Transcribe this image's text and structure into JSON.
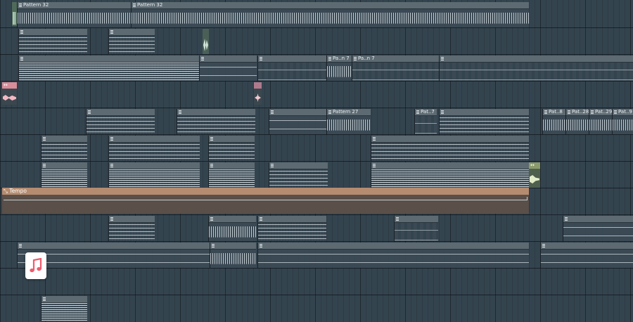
{
  "app": {
    "panel": "Playlist",
    "accent_color": "#b58c70",
    "clip_header_color": "#5d6a72",
    "background_color": "#34444f"
  },
  "clip_labels": {
    "pattern_32": "Pattern 32",
    "pattern_n7": "Pa..n 7",
    "pattern_27": "Pattern 27",
    "pat_7": "Pat..7",
    "pat_8": "Pat..8",
    "pat_28": "Pat..28",
    "pat_29": "Pat..29",
    "pat_9": "Pat..9"
  },
  "tempo": {
    "label": "Tempo",
    "icon": "automation-curve-icon"
  },
  "overlay": {
    "icon": "music-note-icon",
    "icon_color": "#ef5b6e"
  }
}
